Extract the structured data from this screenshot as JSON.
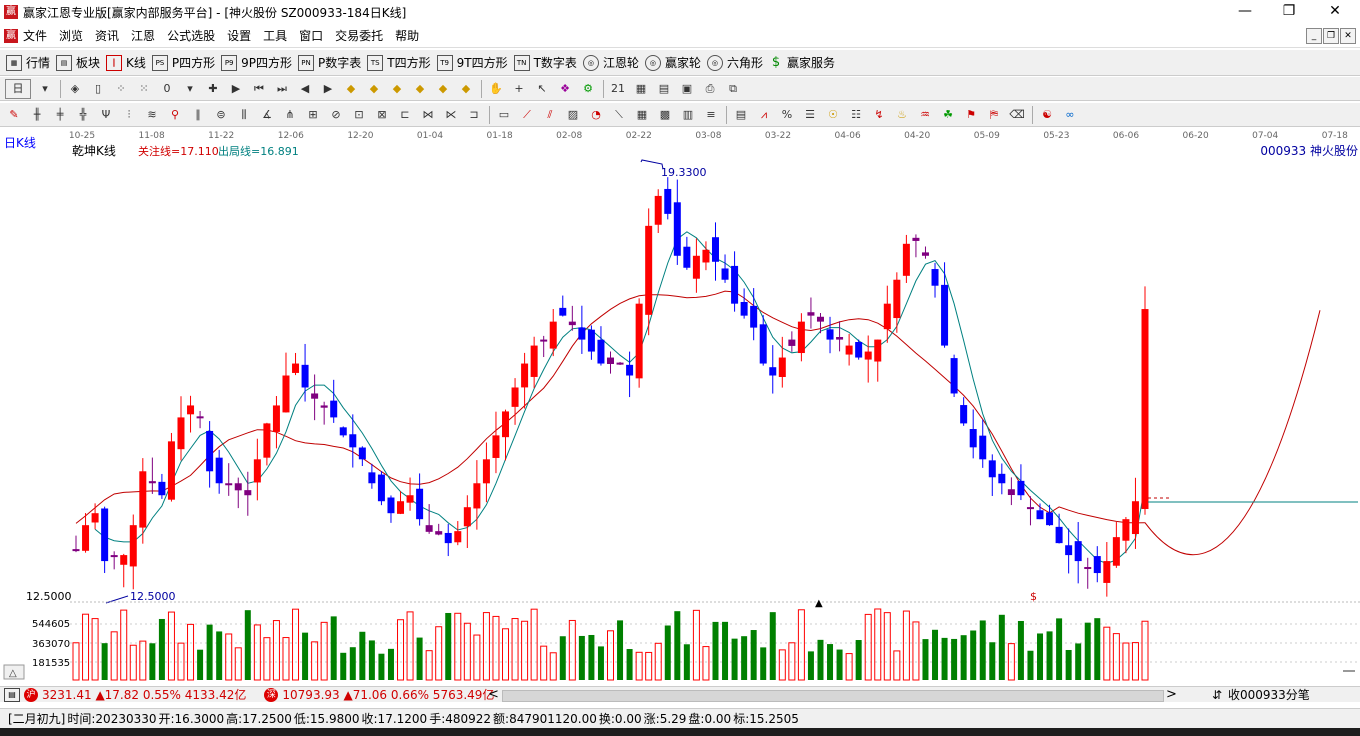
{
  "window": {
    "title": "赢家江恩专业版[赢家内部服务平台] - [神火股份  SZ000933-184日K线]",
    "logo": "赢"
  },
  "menu": {
    "logo": "赢",
    "items": [
      "文件",
      "浏览",
      "资讯",
      "江恩",
      "公式选股",
      "设置",
      "工具",
      "窗口",
      "交易委托",
      "帮助"
    ]
  },
  "toolbar1": [
    {
      "label": "行情",
      "icon": "grid-icon"
    },
    {
      "label": "板块",
      "icon": "blocks-icon"
    },
    {
      "label": "K线",
      "icon": "candle-icon"
    },
    {
      "label": "P四方形",
      "icon": "ps-icon",
      "tag": "PS"
    },
    {
      "label": "9P四方形",
      "icon": "p9-icon",
      "tag": "P9"
    },
    {
      "label": "P数字表",
      "icon": "pn-icon",
      "tag": "PN"
    },
    {
      "label": "T四方形",
      "icon": "ts-icon",
      "tag": "TS"
    },
    {
      "label": "9T四方形",
      "icon": "t9-icon",
      "tag": "T9"
    },
    {
      "label": "T数字表",
      "icon": "tn-icon",
      "tag": "TN"
    },
    {
      "label": "江恩轮",
      "icon": "gann-wheel-icon",
      "tag": "◎"
    },
    {
      "label": "赢家轮",
      "icon": "winner-wheel-icon",
      "tag": "◎"
    },
    {
      "label": "六角形",
      "icon": "hexagon-icon",
      "tag": "◎"
    },
    {
      "label": "赢家服务",
      "icon": "dollar-icon",
      "tag": "$"
    }
  ],
  "toolbar2_period": "日",
  "chart": {
    "period_label": "日K线",
    "indicator_name": "乾坤K线",
    "guanzhu_label": "关注线=17.110",
    "chuju_label": "出局线=16.891",
    "stock_label": "000933  神火股份",
    "high_marker": "19.3300",
    "low_marker": "12.5000",
    "price_axis_label": "12.5000",
    "vol_labels": [
      "544605",
      "363070",
      "181535"
    ],
    "date_ticks": [
      "10-25",
      "11-08",
      "11-22",
      "12-06",
      "12-20",
      "01-04",
      "01-18",
      "02-08",
      "02-22",
      "03-08",
      "03-22",
      "04-06",
      "04-20",
      "05-09",
      "05-23",
      "06-06",
      "06-20",
      "07-04",
      "07-18"
    ],
    "dollar_mark": "$",
    "up_color": "#ff0000",
    "down_color": "#0000ff",
    "neutral_color": "#800080",
    "vol_up_color": "#ff0000",
    "vol_down_color": "#008000",
    "ma_fast_color": "#008080",
    "ma_slow_color": "#c00000"
  },
  "chart_data": {
    "type": "candlestick",
    "title": "神火股份 SZ000933 日K线",
    "price_range": [
      12.5,
      19.33
    ],
    "high": 19.33,
    "low": 12.5,
    "closes": [
      13.1,
      13.5,
      13.7,
      12.9,
      13.0,
      13.0,
      13.5,
      14.4,
      14.2,
      14.0,
      14.9,
      15.3,
      15.5,
      15.3,
      14.4,
      14.2,
      14.2,
      14.2,
      14.0,
      14.6,
      15.2,
      15.5,
      16.0,
      16.2,
      15.8,
      15.7,
      15.5,
      15.3,
      15.0,
      14.8,
      14.6,
      14.2,
      13.9,
      13.7,
      13.9,
      14.0,
      13.6,
      13.5,
      13.4,
      13.2,
      13.4,
      13.8,
      14.2,
      14.6,
      15.0,
      15.4,
      15.8,
      16.2,
      16.5,
      16.6,
      16.9,
      17.0,
      16.9,
      16.6,
      16.4,
      16.2,
      16.3,
      16.2,
      16.0,
      17.2,
      18.5,
      19.0,
      18.7,
      18.0,
      17.8,
      18.0,
      18.1,
      17.9,
      17.6,
      17.2,
      17.0,
      16.8,
      16.2,
      16.0,
      16.3,
      16.6,
      16.9,
      17.0,
      16.9,
      16.6,
      16.6,
      16.5,
      16.3,
      16.4,
      16.6,
      17.2,
      17.6,
      18.2,
      18.3,
      18.0,
      17.5,
      16.5,
      15.7,
      15.2,
      14.8,
      14.6,
      14.3,
      14.2,
      14.1,
      14.0,
      13.8,
      13.6,
      13.5,
      13.2,
      13.0,
      12.9,
      12.8,
      12.7,
      12.9,
      13.3,
      13.6,
      13.9,
      17.11
    ],
    "volume_labels": [
      544605,
      363070,
      181535
    ],
    "last_bar": {
      "lunar_date": "二月初九",
      "time": "20230330",
      "open": 16.3,
      "high": 17.25,
      "low": 15.98,
      "close": 17.12,
      "hand": 480922,
      "amount": 847901120.0,
      "turnover": 0.0,
      "change": 5.29,
      "pan": 0.0,
      "biao": 15.2505
    }
  },
  "scroll": {
    "sh_index": "3231.41 ▲17.82 0.55% 4133.42亿",
    "sz_index": "10793.93 ▲71.06 0.66% 5763.49亿",
    "sh_tag": "沪",
    "sz_tag": "深",
    "right_label": "收000933分笔"
  },
  "status": {
    "lunar": "[二月初九]",
    "time": "时间:20230330",
    "open": "开:16.3000",
    "high": "高:17.2500",
    "low": "低:15.9800",
    "close": "收:17.1200",
    "hand": "手:480922",
    "amount": "额:847901120.00",
    "turnover": "换:0.00",
    "change": "涨:5.29",
    "pan": "盘:0.00",
    "biao": "标:15.2505"
  }
}
